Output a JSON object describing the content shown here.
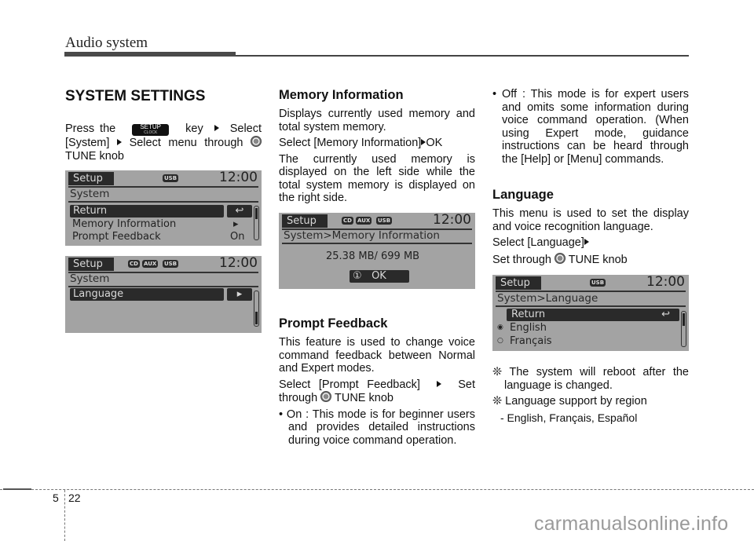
{
  "header": {
    "title": "Audio system"
  },
  "col1": {
    "heading": "SYSTEM SETTINGS",
    "intro": {
      "part1": "Press the",
      "key_top": "SETUP",
      "key_bottom": "CLOCK",
      "part2": "key",
      "part3": "Select",
      "part4": "[System]",
      "part5": "Select menu through",
      "part6": "TUNE knob"
    },
    "screen1": {
      "mode": "Setup",
      "badges": [
        "USB"
      ],
      "clock": "12:00",
      "path": "System",
      "items": [
        {
          "label": "Return",
          "value": "return-icon",
          "selected": true
        },
        {
          "label": "Memory Information",
          "value": "▸",
          "selected": false
        },
        {
          "label": "Prompt Feedback",
          "value": "On",
          "selected": false
        }
      ]
    },
    "screen2": {
      "mode": "Setup",
      "badges": [
        "CD",
        "AUX",
        "USB"
      ],
      "clock": "12:00",
      "path": "System",
      "items": [
        {
          "label": "Language",
          "value": "▸",
          "selected": true
        }
      ]
    }
  },
  "col2": {
    "mem_heading": "Memory Information",
    "mem_p1": "Displays currently used memory and total system memory.",
    "mem_p2_a": "Select [Memory Information]",
    "mem_p2_b": "OK",
    "mem_p3": "The currently used memory is displayed on the left side while the total system memory is displayed on the right side.",
    "screen3": {
      "mode": "Setup",
      "badges": [
        "CD",
        "AUX",
        "USB"
      ],
      "clock": "12:00",
      "path": "System>Memory Information",
      "memory": "25.38 MB/ 699 MB",
      "ok_num": "①",
      "ok_label": "OK"
    },
    "pf_heading": "Prompt Feedback",
    "pf_p1": "This feature is used to change voice command feedback between Normal and Expert modes.",
    "pf_p2_a": "Select [Prompt Feedback]",
    "pf_p2_b": "Set through",
    "pf_p2_c": "TUNE knob",
    "pf_on": "• On : This mode is for beginner users and provides detailed instructions during voice command operation."
  },
  "col3": {
    "pf_off": "• Off : This mode is for expert users and omits some information during voice command operation. (When using Expert mode, guidance instructions can be heard through the [Help] or [Menu] commands.",
    "lang_heading": "Language",
    "lang_p1": "This menu is used to set the display and voice recognition language.",
    "lang_p2": "Select [Language]",
    "lang_p3_a": "Set through",
    "lang_p3_b": "TUNE knob",
    "screen4": {
      "mode": "Setup",
      "badges": [
        "USB"
      ],
      "clock": "12:00",
      "path": "System>Language",
      "items": [
        {
          "label": "Return",
          "selected": true
        },
        {
          "label": "English",
          "radio": "selected"
        },
        {
          "label": "Français",
          "radio": "unselected"
        }
      ]
    },
    "note1": "❊ The system will reboot after the language is changed.",
    "note2": "❊ Language support by region",
    "note3": "- English, Français, Español"
  },
  "footer": {
    "chapter": "5",
    "page": "22",
    "watermark": "carmanualsonline.info"
  }
}
